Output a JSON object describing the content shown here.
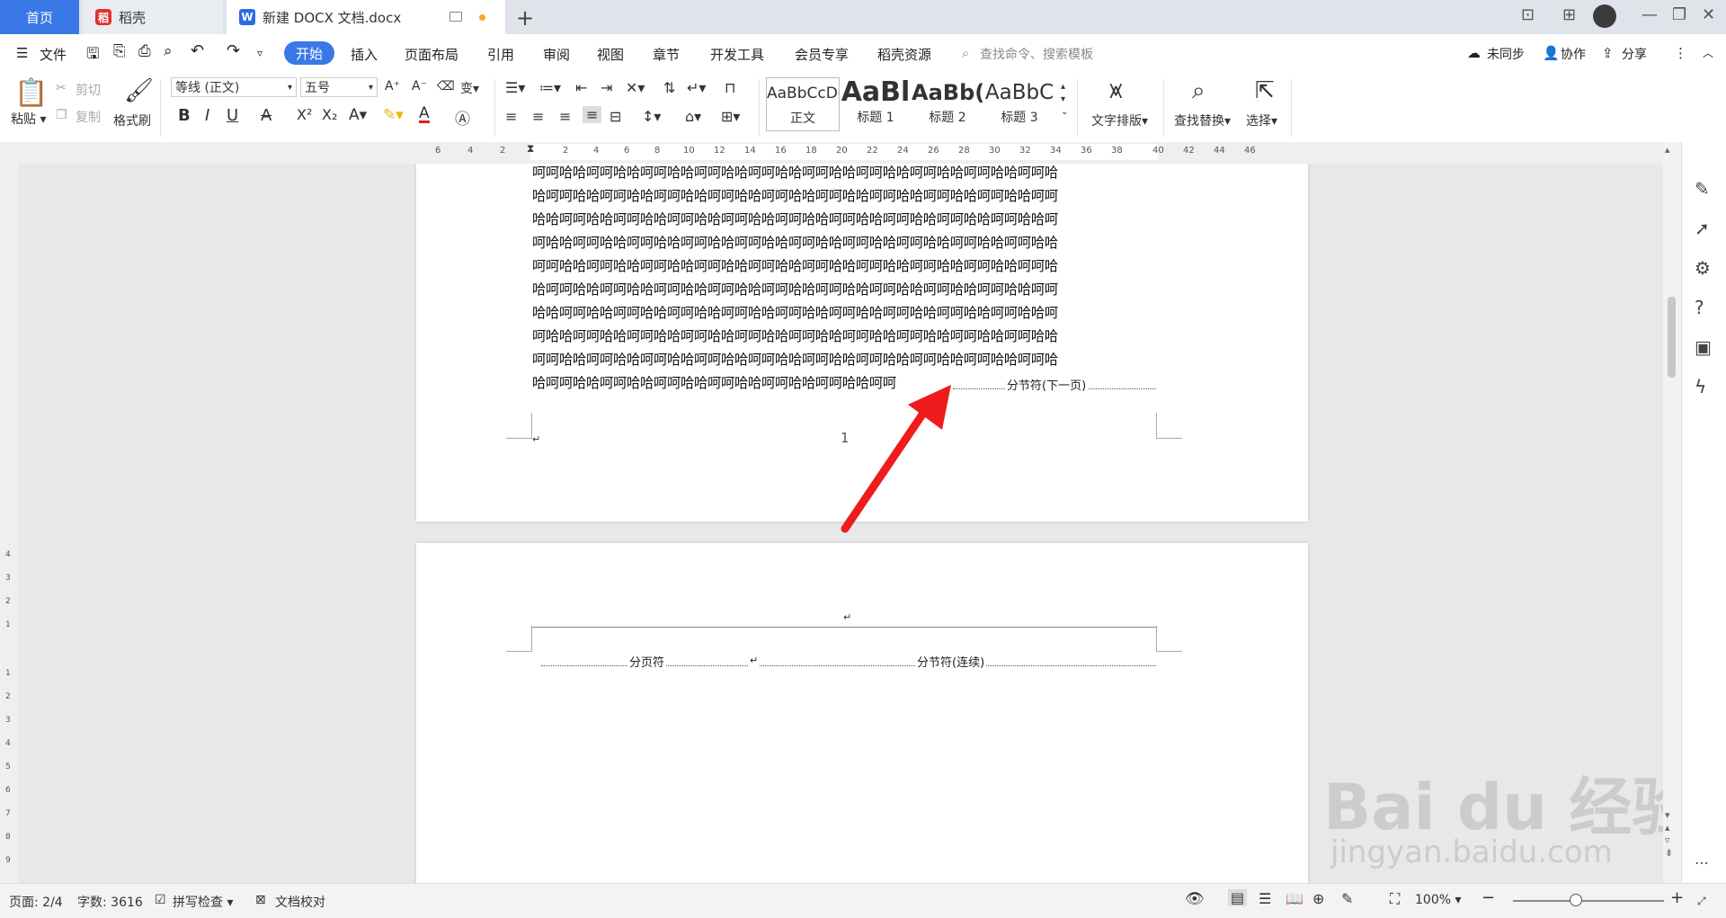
{
  "tabs": {
    "home": "首页",
    "daoke": "稻壳",
    "document": "新建 DOCX 文档.docx"
  },
  "menu": {
    "file": "文件",
    "items": [
      "开始",
      "插入",
      "页面布局",
      "引用",
      "审阅",
      "视图",
      "章节",
      "开发工具",
      "会员专享",
      "稻壳资源"
    ],
    "search_placeholder": "查找命令、搜索模板",
    "unsynced": "未同步",
    "collaborate": "协作",
    "share": "分享"
  },
  "ribbon": {
    "paste": "粘贴",
    "cut": "剪切",
    "copy": "复制",
    "format_painter": "格式刷",
    "font_name": "等线 (正文)",
    "font_size": "五号",
    "styles": [
      {
        "preview": "AaBbCcDc",
        "name": "正文"
      },
      {
        "preview": "AaBl",
        "name": "标题 1"
      },
      {
        "preview": "AaBb(",
        "name": "标题 2"
      },
      {
        "preview": "AaBbC",
        "name": "标题 3"
      }
    ],
    "text_layout": "文字排版",
    "find_replace": "查找替换",
    "select": "选择"
  },
  "ruler": {
    "left_ticks": [
      "6",
      "4",
      "2"
    ],
    "right_ticks": [
      "2",
      "4",
      "6",
      "8",
      "10",
      "12",
      "14",
      "16",
      "18",
      "20",
      "22",
      "24",
      "26",
      "28",
      "30",
      "32",
      "34",
      "36",
      "38",
      "40",
      "42",
      "44",
      "46"
    ],
    "vertical_ticks": [
      "4",
      "3",
      "2",
      "1",
      "1",
      "2",
      "3",
      "4",
      "5",
      "6",
      "7",
      "8",
      "9"
    ]
  },
  "document": {
    "page1_lines": [
      "呵呵哈哈呵呵哈哈呵呵哈哈呵呵哈哈呵呵哈哈呵呵哈哈呵呵哈哈呵呵哈哈呵呵哈哈呵呵哈",
      "哈呵呵哈哈呵呵哈哈呵呵哈哈呵呵哈哈呵呵哈哈呵呵哈哈呵呵哈哈呵呵哈哈呵呵哈哈呵呵",
      "哈哈呵呵哈哈呵呵哈哈呵呵哈哈呵呵哈哈呵呵哈哈呵呵哈哈呵呵哈哈呵呵哈哈呵呵哈哈呵",
      "呵哈哈呵呵哈哈呵呵哈哈呵呵哈哈呵呵哈哈呵呵哈哈呵呵哈哈呵呵哈哈呵呵哈哈呵呵哈哈",
      "呵呵哈哈呵呵哈哈呵呵哈哈呵呵哈哈呵呵哈哈呵呵哈哈呵呵哈哈呵呵哈哈呵呵哈哈呵呵哈",
      "哈呵呵哈哈呵呵哈哈呵呵哈哈呵呵哈哈呵呵哈哈呵呵哈哈呵呵哈哈呵呵哈哈呵呵哈哈呵呵",
      "哈哈呵呵哈哈呵呵哈哈呵呵哈哈呵呵哈哈呵呵哈哈呵呵哈哈呵呵哈哈呵呵哈哈呵呵哈哈呵",
      "呵哈哈呵呵哈哈呵呵哈哈呵呵哈哈呵呵哈哈呵呵哈哈呵呵哈哈呵呵哈哈呵呵哈哈呵呵哈哈",
      "呵呵哈哈呵呵哈哈呵呵哈哈呵呵哈哈呵呵哈哈呵呵哈哈呵呵哈哈呵呵哈哈呵呵哈哈呵呵哈"
    ],
    "page1_last_line": "哈呵呵哈哈呵呵哈哈呵呵哈哈呵呵哈哈呵呵哈哈呵呵哈哈呵呵",
    "section_break_next": "分节符(下一页)",
    "page_number": "1",
    "page_break": "分页符",
    "section_break_continuous": "分节符(连续)",
    "paragraph_mark": "↵"
  },
  "status": {
    "page": "页面: 2/4",
    "words": "字数: 3616",
    "spell_check": "拼写检查",
    "doc_proof": "文档校对",
    "zoom": "100%"
  },
  "watermark": {
    "main": "Bai du 经验",
    "sub": "jingyan.baidu.com"
  },
  "colors": {
    "accent": "#3a78e7",
    "arrow": "#ee1c1c"
  }
}
